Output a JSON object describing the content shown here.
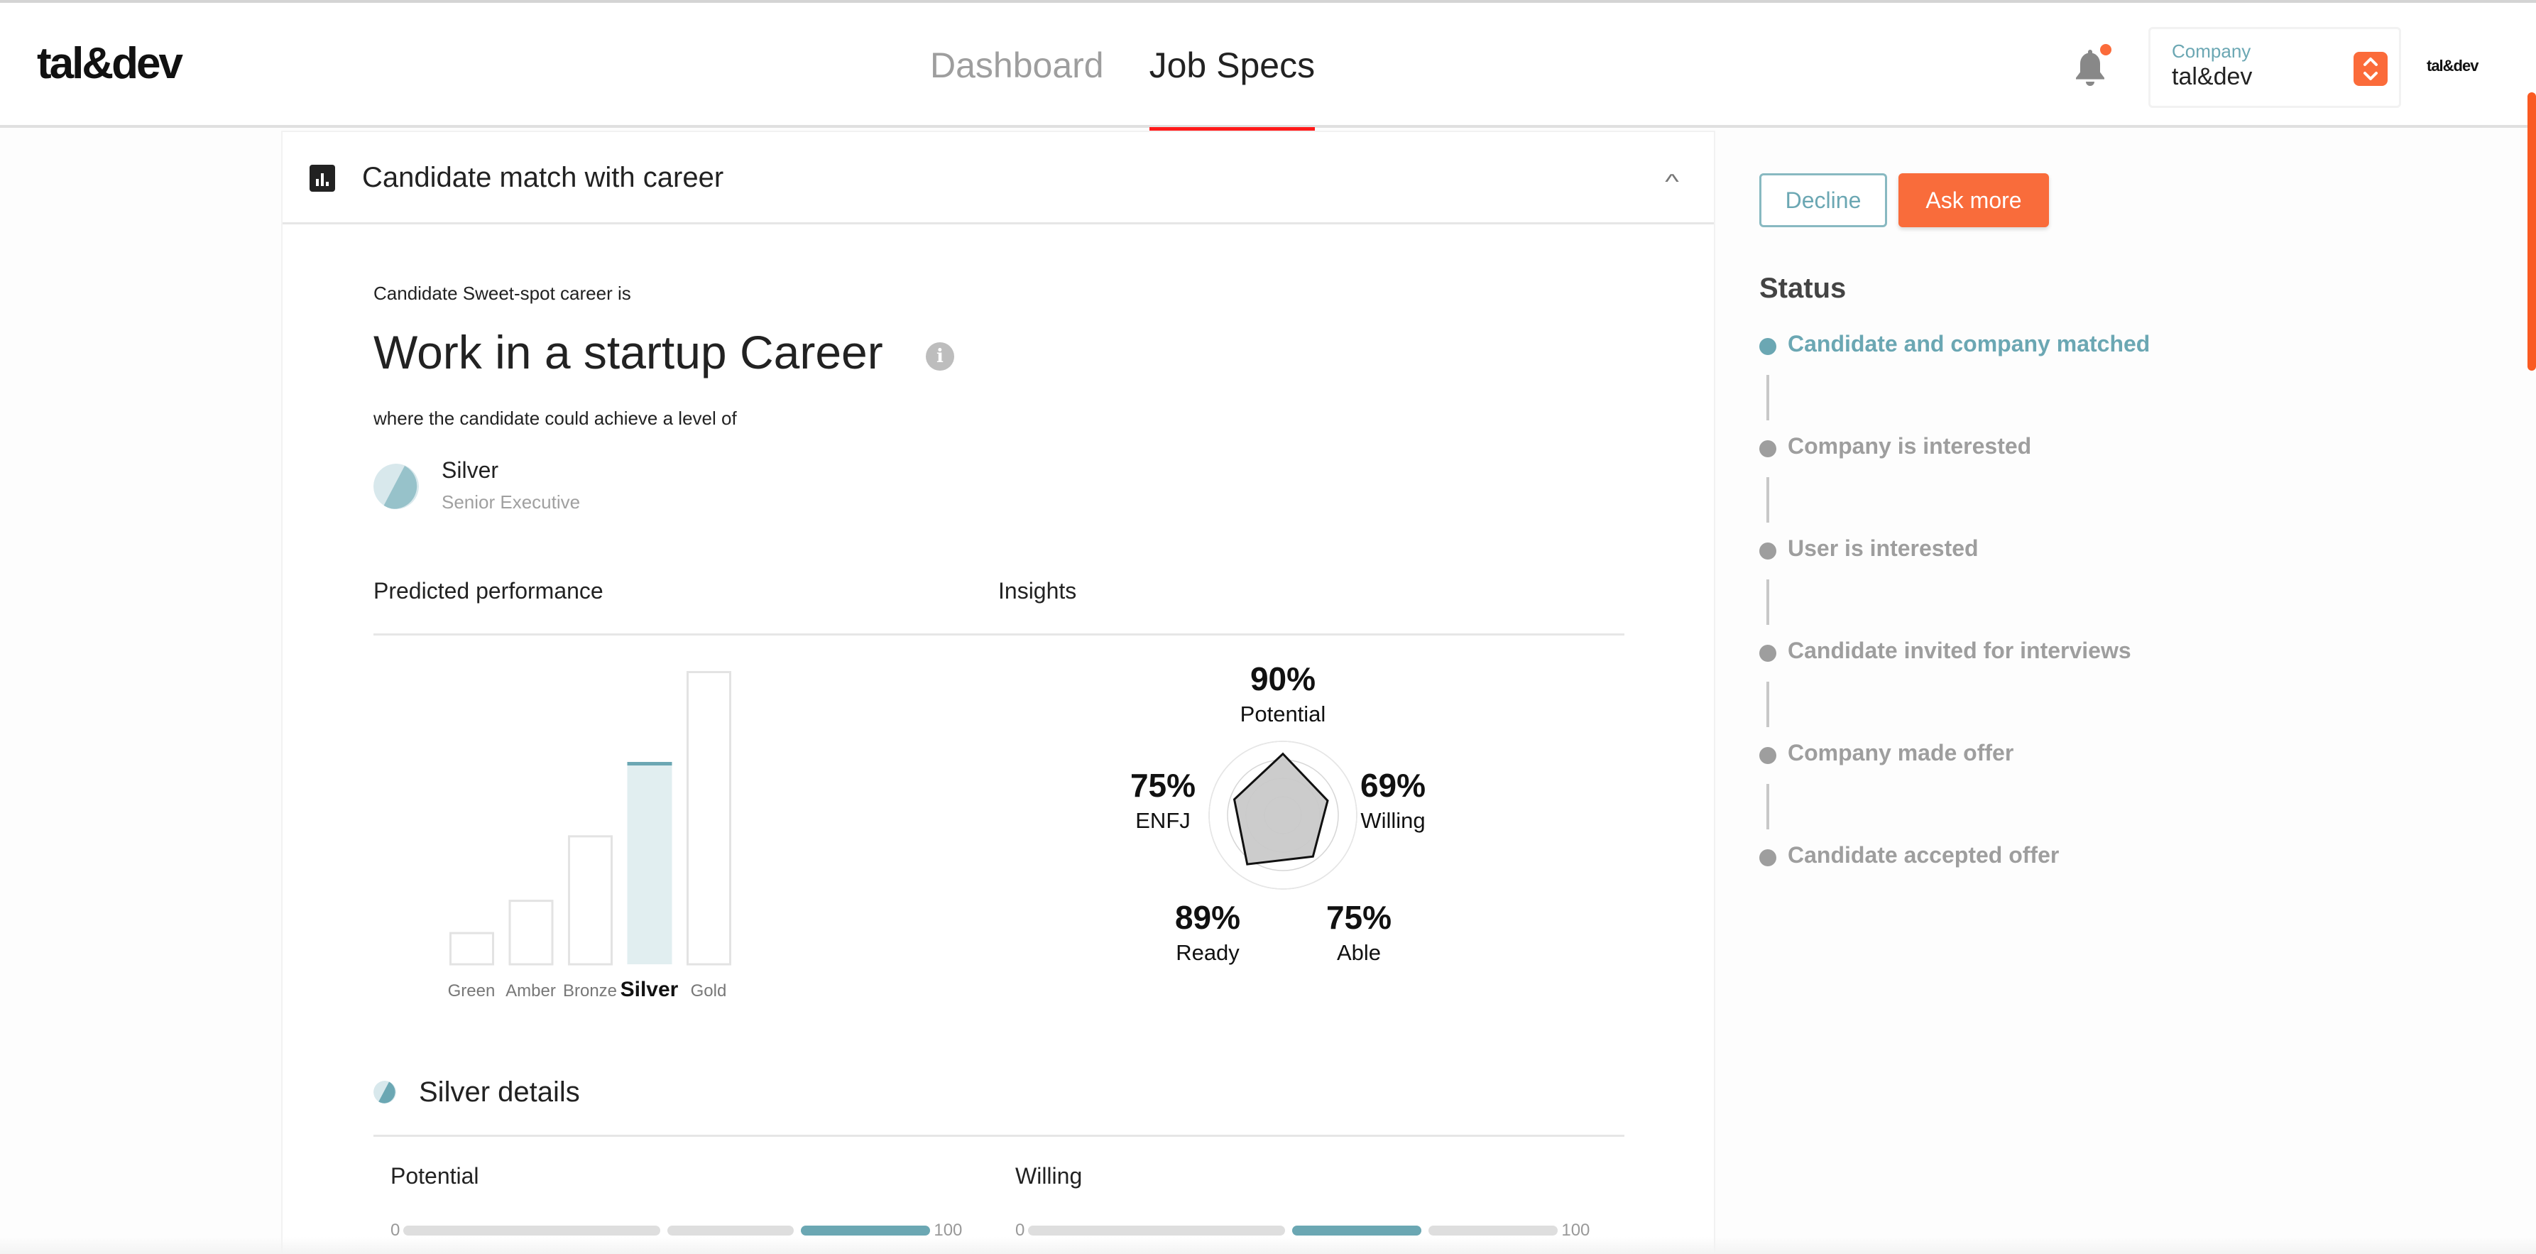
{
  "header": {
    "logo": "tal&dev",
    "nav": [
      {
        "label": "Dashboard",
        "active": false
      },
      {
        "label": "Job Specs",
        "active": true
      }
    ],
    "notifications": {
      "icon": "bell-icon",
      "has_unread": true
    },
    "company_selector": {
      "label": "Company",
      "value": "tal&dev",
      "icon": "chevron-up-down-icon"
    },
    "user_logo": "tal&dev"
  },
  "card": {
    "title": "Candidate match with career",
    "icon": "bar-chart-icon",
    "collapse_icon": "chevron-up-icon",
    "intro": "Candidate Sweet-spot career is",
    "career": "Work in a startup Career",
    "level_intro": "where the candidate could achieve a level of",
    "level": {
      "name": "Silver",
      "subtitle": "Senior Executive"
    },
    "predicted_label": "Predicted performance",
    "insights_label": "Insights",
    "details_title": "Silver details",
    "metrics": [
      {
        "label": "Potential",
        "min": "0",
        "max": "100",
        "active_segment": 2
      },
      {
        "label": "Willing",
        "min": "0",
        "max": "100",
        "active_segment": 1
      }
    ]
  },
  "chart_data": [
    {
      "type": "bar",
      "title": "Predicted performance",
      "categories": [
        "Green",
        "Amber",
        "Bronze",
        "Silver",
        "Gold"
      ],
      "values": [
        11,
        22,
        44,
        69,
        100
      ],
      "highlighted": "Silver",
      "ylim": [
        0,
        100
      ],
      "grid": false,
      "colors": {
        "outline": "#e3e3e3",
        "highlight_fill": "#e1eef0",
        "highlight_top": "#6ba7b3"
      }
    },
    {
      "type": "radar",
      "title": "Insights",
      "axes": [
        "Potential",
        "Willing",
        "Able",
        "Ready",
        "ENFJ"
      ],
      "values": [
        90,
        69,
        75,
        89,
        75
      ],
      "value_labels": [
        "90%",
        "69%",
        "75%",
        "89%",
        "75%"
      ],
      "range": [
        0,
        100
      ],
      "rings": 4
    }
  ],
  "sidebar": {
    "decline_label": "Decline",
    "ask_more_label": "Ask more",
    "status_title": "Status",
    "steps": [
      {
        "label": "Candidate and company matched",
        "done": true
      },
      {
        "label": "Company is interested",
        "done": false
      },
      {
        "label": "User is interested",
        "done": false
      },
      {
        "label": "Candidate invited for interviews",
        "done": false
      },
      {
        "label": "Company made offer",
        "done": false
      },
      {
        "label": "Candidate accepted offer",
        "done": false
      }
    ]
  },
  "colors": {
    "accent": "#f96c3b",
    "teal": "#6ba7b3",
    "active_tab": "#ff1a1a"
  }
}
